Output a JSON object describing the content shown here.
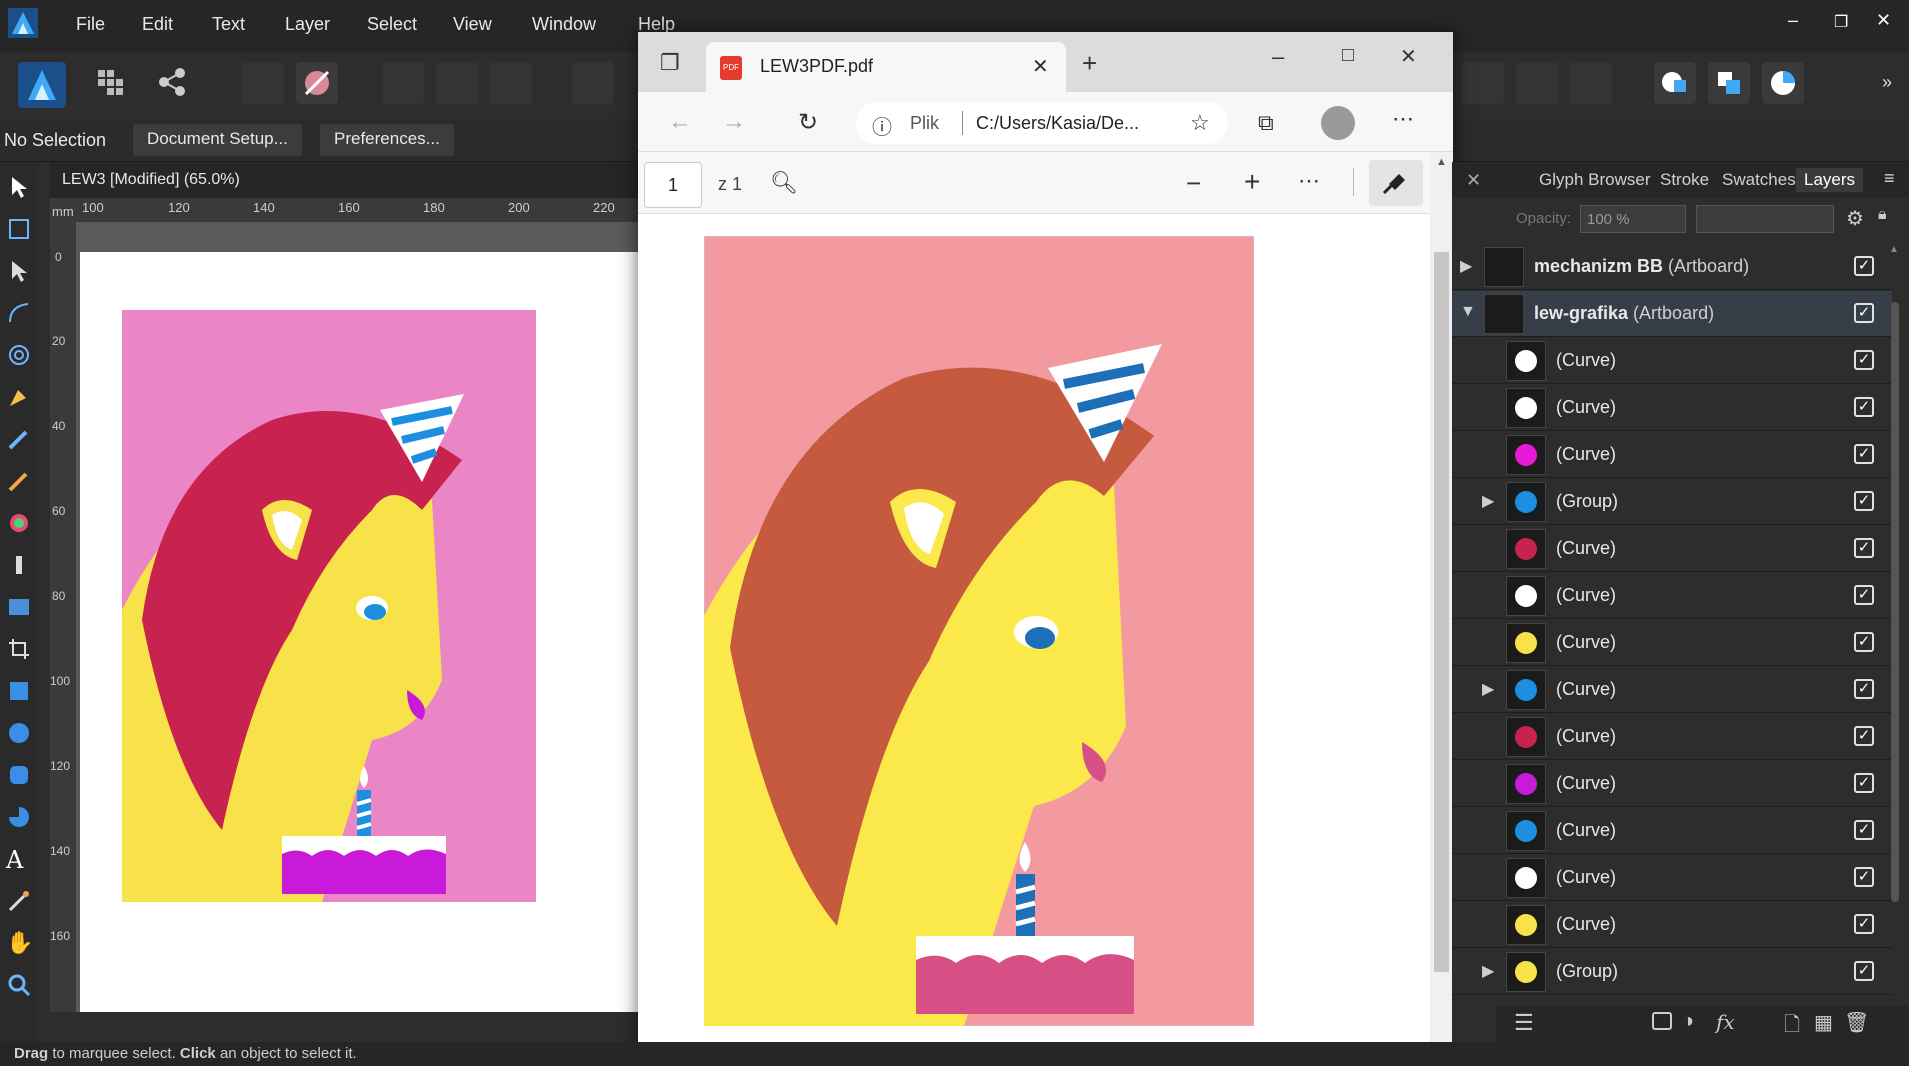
{
  "app": {
    "menu": [
      "File",
      "Edit",
      "Text",
      "Layer",
      "Select",
      "View",
      "Window",
      "Help"
    ]
  },
  "context": {
    "selection": "No Selection",
    "document_setup": "Document Setup...",
    "preferences": "Preferences..."
  },
  "document": {
    "tab_label": "LEW3 [Modified] (65.0%)",
    "ruler_unit": "mm",
    "ruler_h": [
      "100",
      "120",
      "140",
      "160",
      "180",
      "200",
      "220"
    ],
    "ruler_v": [
      "0",
      "20",
      "40",
      "60",
      "80",
      "100",
      "120",
      "140",
      "160"
    ],
    "colors": {
      "bg": "#ea86c6",
      "mane": "#c8224e",
      "face": "#f8e24a",
      "hat": "#1d8fe0",
      "cake": "#c81ad8"
    }
  },
  "browser": {
    "tab_title": "LEW3PDF.pdf",
    "address_prefix": "Plik",
    "address": "C:/Users/Kasia/De...",
    "page_number": "1",
    "page_total": "z 1",
    "colors": {
      "bg": "#f29aa0",
      "mane": "#c55a3e",
      "face": "#fbe94c",
      "hat": "#1d6fb8",
      "cake": "#d84f86"
    }
  },
  "panel": {
    "tabs": [
      "Glyph Browser",
      "Stroke",
      "Swatches",
      "Layers"
    ],
    "active_tab": "Layers",
    "opacity_label": "Opacity:",
    "opacity_value": "100 %",
    "layers": [
      {
        "name": "mechanizm BB",
        "suffix": "(Artboard)",
        "bold": true,
        "arrow": "right",
        "indent": 0,
        "checked": true
      },
      {
        "name": "lew-grafika",
        "suffix": "(Artboard)",
        "bold": true,
        "arrow": "down",
        "indent": 0,
        "checked": true
      },
      {
        "name": "(Curve)",
        "suffix": "",
        "bold": false,
        "arrow": "",
        "indent": 1,
        "checked": true
      },
      {
        "name": "(Curve)",
        "suffix": "",
        "bold": false,
        "arrow": "",
        "indent": 1,
        "checked": true
      },
      {
        "name": "(Curve)",
        "suffix": "",
        "bold": false,
        "arrow": "",
        "indent": 1,
        "checked": true
      },
      {
        "name": "(Group)",
        "suffix": "",
        "bold": false,
        "arrow": "right",
        "indent": 1,
        "checked": true
      },
      {
        "name": "(Curve)",
        "suffix": "",
        "bold": false,
        "arrow": "",
        "indent": 1,
        "checked": true
      },
      {
        "name": "(Curve)",
        "suffix": "",
        "bold": false,
        "arrow": "",
        "indent": 1,
        "checked": true
      },
      {
        "name": "(Curve)",
        "suffix": "",
        "bold": false,
        "arrow": "",
        "indent": 1,
        "checked": true
      },
      {
        "name": "(Curve)",
        "suffix": "",
        "bold": false,
        "arrow": "right",
        "indent": 1,
        "checked": true
      },
      {
        "name": "(Curve)",
        "suffix": "",
        "bold": false,
        "arrow": "",
        "indent": 1,
        "checked": true
      },
      {
        "name": "(Curve)",
        "suffix": "",
        "bold": false,
        "arrow": "",
        "indent": 1,
        "checked": true
      },
      {
        "name": "(Curve)",
        "suffix": "",
        "bold": false,
        "arrow": "",
        "indent": 1,
        "checked": true
      },
      {
        "name": "(Curve)",
        "suffix": "",
        "bold": false,
        "arrow": "",
        "indent": 1,
        "checked": true
      },
      {
        "name": "(Curve)",
        "suffix": "",
        "bold": false,
        "arrow": "",
        "indent": 1,
        "checked": true
      },
      {
        "name": "(Group)",
        "suffix": "",
        "bold": false,
        "arrow": "right",
        "indent": 1,
        "checked": true
      }
    ]
  },
  "status": {
    "drag": "Drag",
    "drag_text": " to marquee select. ",
    "click": "Click",
    "click_text": " an object to select it."
  }
}
